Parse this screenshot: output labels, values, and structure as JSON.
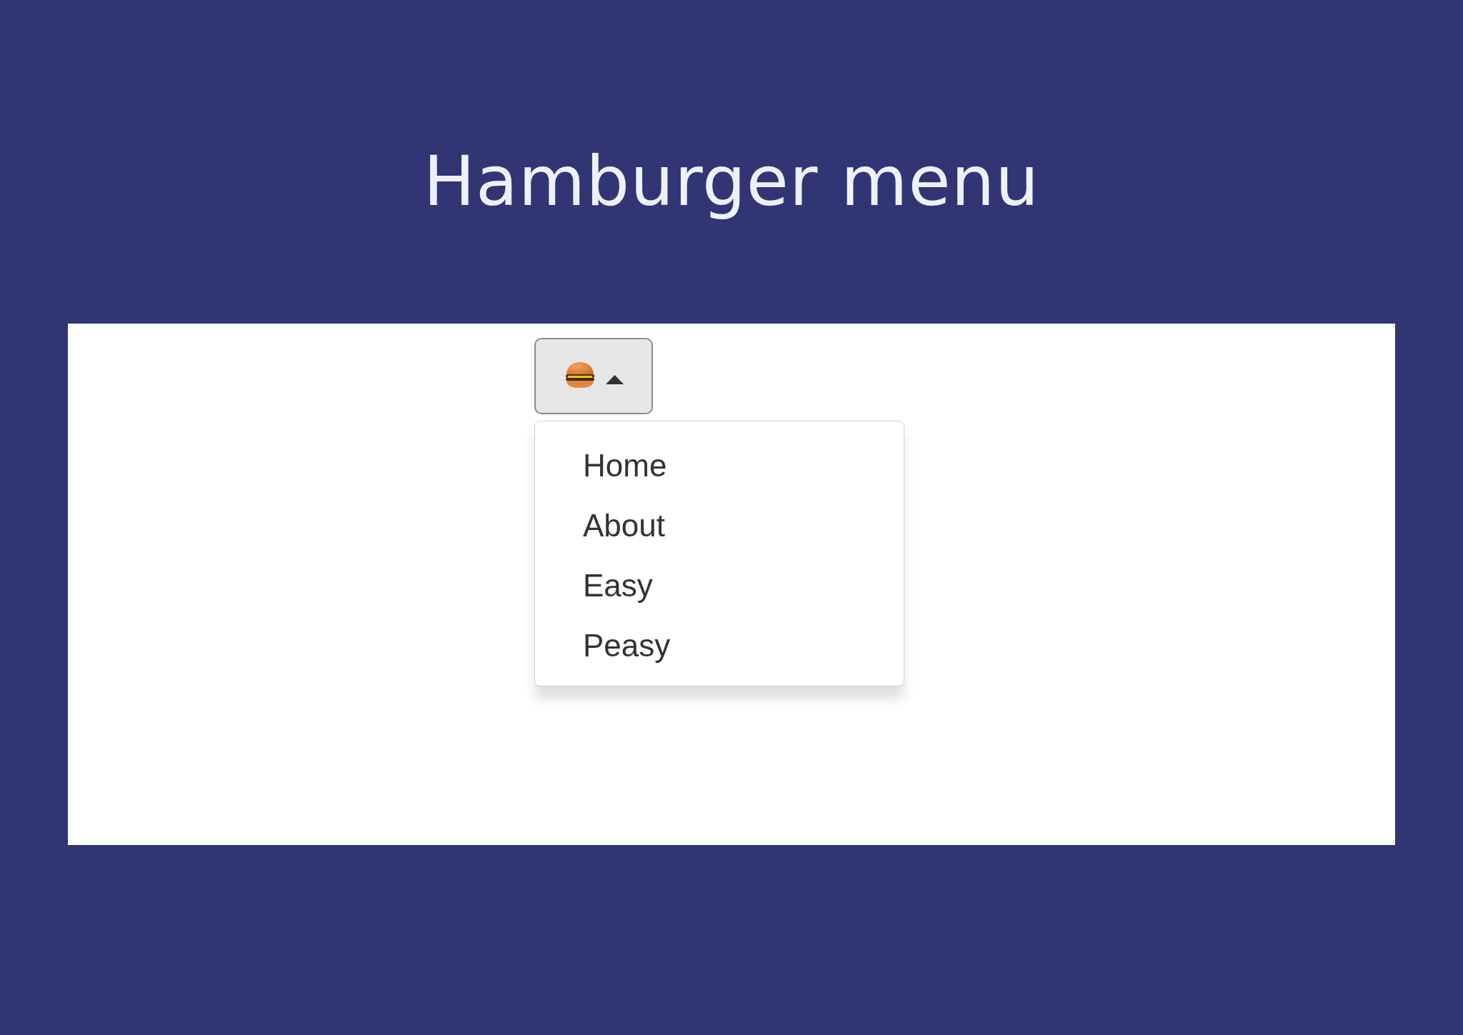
{
  "title": "Hamburger menu",
  "menu_button": {
    "expanded": true
  },
  "menu": {
    "items": [
      {
        "label": "Home"
      },
      {
        "label": "About"
      },
      {
        "label": "Easy"
      },
      {
        "label": "Peasy"
      }
    ]
  }
}
